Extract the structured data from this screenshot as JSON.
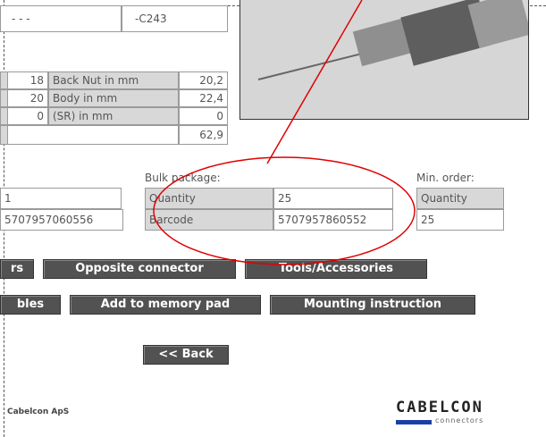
{
  "top": {
    "dots": "- - -",
    "code": "-C243"
  },
  "dims": {
    "rows": [
      {
        "left": "18",
        "label": "Back Nut in mm",
        "value": "20,2"
      },
      {
        "left": "20",
        "label": "Body in mm",
        "value": "22,4"
      },
      {
        "left": "0",
        "label": "(SR) in mm",
        "value": "0"
      }
    ],
    "total": "62,9"
  },
  "unit_package": {
    "quantity": "1",
    "barcode": "5707957060556"
  },
  "bulk_package": {
    "title": "Bulk package:",
    "quantity_label": "Quantity",
    "quantity_value": "25",
    "barcode_label": "Barcode",
    "barcode_value": "5707957860552"
  },
  "min_order": {
    "title": "Min. order:",
    "quantity_label": "Quantity",
    "quantity_value": "25"
  },
  "buttons": {
    "row1": [
      "rs",
      "Opposite connector",
      "Tools/Accessories"
    ],
    "row2": [
      "bles",
      "Add to memory pad",
      "Mounting instruction"
    ],
    "back": "<< Back"
  },
  "footer": {
    "company": "Cabelcon ApS",
    "logo_name": "CABELCON",
    "logo_sub": "connectors"
  },
  "colors": {
    "button_bg": "#525252",
    "annotation": "#e00000",
    "logo_bar": "#1a3ea8"
  }
}
